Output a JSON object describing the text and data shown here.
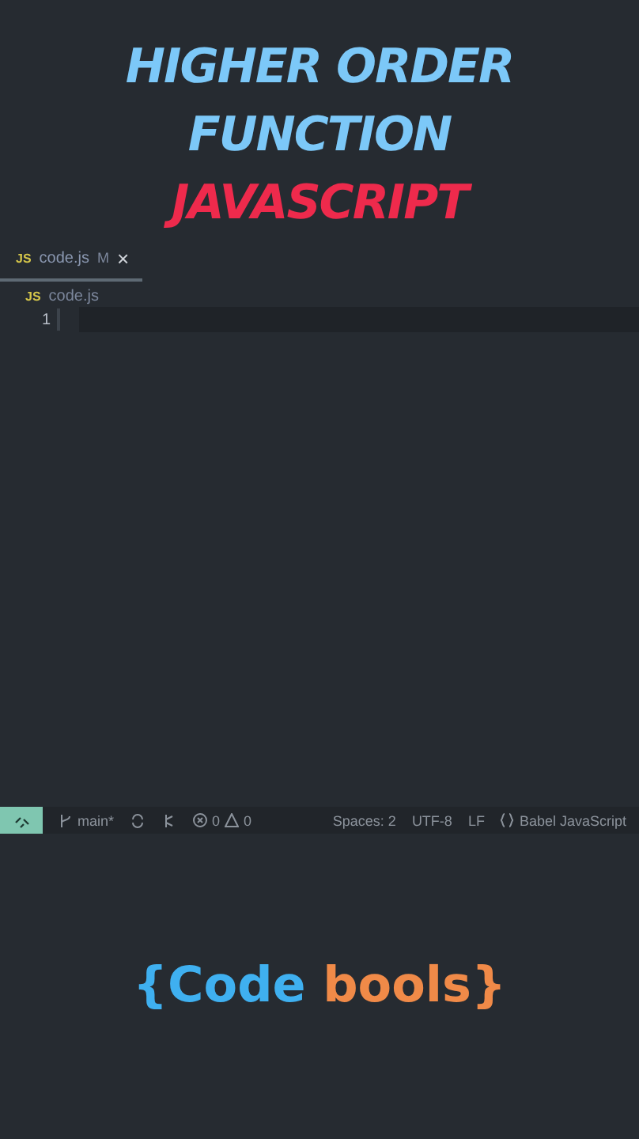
{
  "headline": [
    {
      "text": "HIGHER ORDER",
      "color": "#7cc8f8"
    },
    {
      "text": "FUNCTION",
      "color": "#7cc8f8"
    },
    {
      "text": "JAVASCRIPT",
      "color": "#ee2a4c"
    }
  ],
  "tabs": [
    {
      "badge": "JS",
      "label": "code.js",
      "status": "M",
      "close": "×",
      "selected": true
    }
  ],
  "breadcrumb": {
    "badge": "JS",
    "label": "code.js"
  },
  "editor": {
    "line_numbers": [
      "1"
    ]
  },
  "status_bar": {
    "branch": "main*",
    "errors": "0",
    "warnings": "0",
    "items": [
      "Spaces: 2",
      "UTF-8",
      "LF"
    ],
    "language": "Babel JavaScript"
  },
  "brand": [
    {
      "text": "{Code",
      "color": "#3fb0f0"
    },
    {
      "text": " bools}",
      "color": "#f08a48"
    }
  ]
}
